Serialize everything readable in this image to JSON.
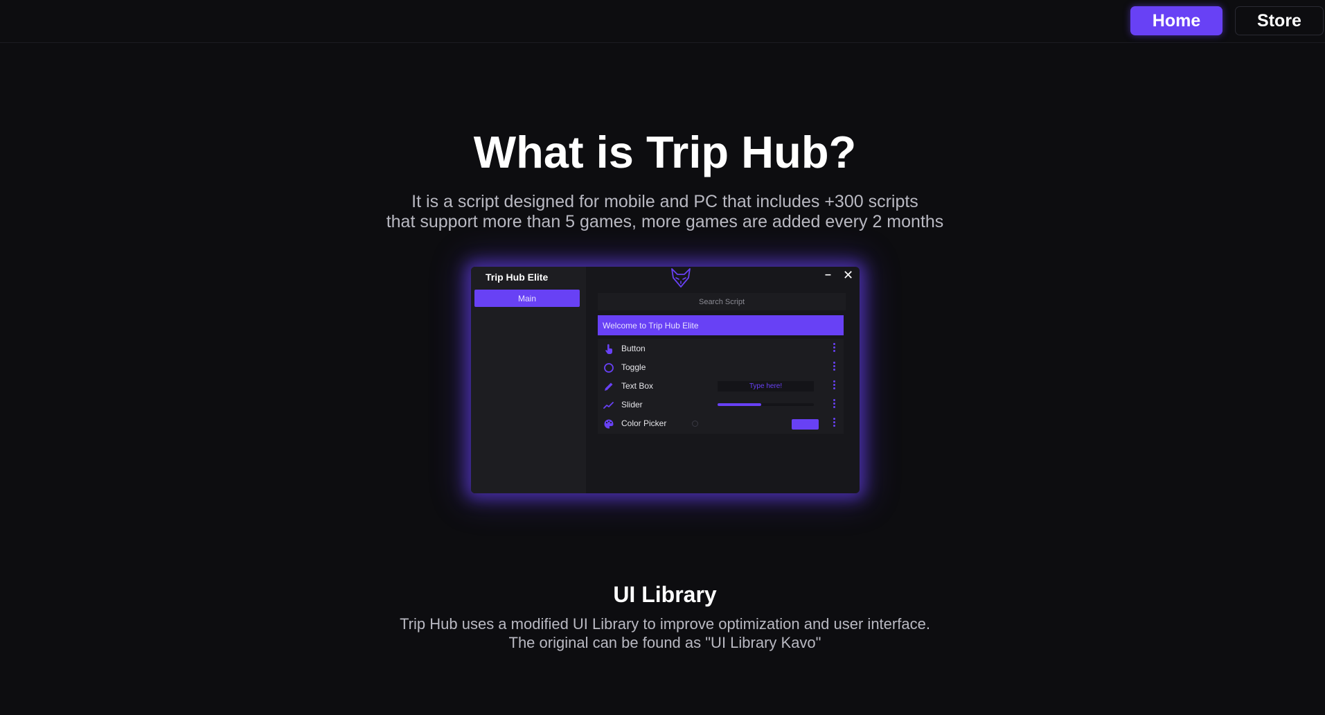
{
  "nav": {
    "home_label": "Home",
    "store_label": "Store"
  },
  "hero": {
    "title": "What is Trip Hub?",
    "subtitle_line1": "It is a script designed for mobile and PC that includes +300 scripts",
    "subtitle_line2": "that support more than 5 games, more games are added every 2 months"
  },
  "mock_ui": {
    "window_title": "Trip Hub Elite",
    "logo_icon": "fox-head-icon",
    "minimize_symbol": "–",
    "close_symbol": "✕",
    "tab_label": "Main",
    "search_placeholder": "Search Script",
    "welcome_label": "Welcome to Trip Hub Elite",
    "rows": [
      {
        "label": "Button",
        "icon": "pointer-hand-icon"
      },
      {
        "label": "Toggle",
        "icon": "circle-outline-icon"
      },
      {
        "label": "Text Box",
        "icon": "pencil-icon",
        "placeholder": "Type here!"
      },
      {
        "label": "Slider",
        "icon": "trend-line-icon",
        "value_fraction": 0.45
      },
      {
        "label": "Color Picker",
        "icon": "palette-icon",
        "color": "#6841f5"
      }
    ]
  },
  "library": {
    "title": "UI Library",
    "line1": "Trip Hub uses a modified UI Library to improve optimization and user interface.",
    "line2": "The original can be found as \"UI Library Kavo\""
  },
  "colors": {
    "accent": "#6841f5",
    "background": "#0d0d10",
    "panel": "#17171b",
    "muted_text": "#b9b9c2"
  }
}
